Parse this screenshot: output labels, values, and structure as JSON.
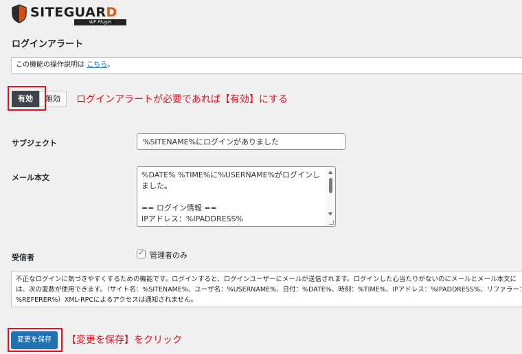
{
  "logo": {
    "text_main": "SITEGUAR",
    "text_accent": "D",
    "subtitle": "WP Plugin"
  },
  "page_title": "ログインアラート",
  "info": {
    "text": "この機能の操作説明は ",
    "link_label": "こちら",
    "suffix": "。"
  },
  "toggle": {
    "on_label": "有効",
    "off_label": "無効",
    "state": "on"
  },
  "annotations": {
    "toggle_note": "ログインアラートが必要であれば【有効】にする",
    "save_note": "【変更を保存】をクリック",
    "highlight_color": "#e2121f"
  },
  "form": {
    "subject_label": "サブジェクト",
    "subject_value": "%SITENAME%にログインがありました",
    "body_label": "メール本文",
    "body_value": "%DATE% %TIME%に%USERNAME%がログインしました。\n\n== ログイン情報 ==\nIPアドレス：%IPADDRESS%",
    "recipient_label": "受信者",
    "recipient_checkbox_label": "管理者のみ",
    "recipient_checked": true
  },
  "description": "不正なログインに気づきやすくするための機能です。ログインすると、ログインユーザーにメールが送信されます。ログインした心当たりがないのにメールとメール本文には、次の変数が使用できます。（サイト名：%SITENAME%、ユーザ名：%USERNAME%、日付：%DATE%、時刻：%TIME%、IPアドレス：%IPADDRESS%、リファラー：%REFERER%）XML-RPCによるアクセスは通知されません。",
  "save_button_label": "変更を保存",
  "colors": {
    "primary": "#2271b1",
    "toggle_on": "#3c434a",
    "logo_accent": "#e05a18"
  }
}
